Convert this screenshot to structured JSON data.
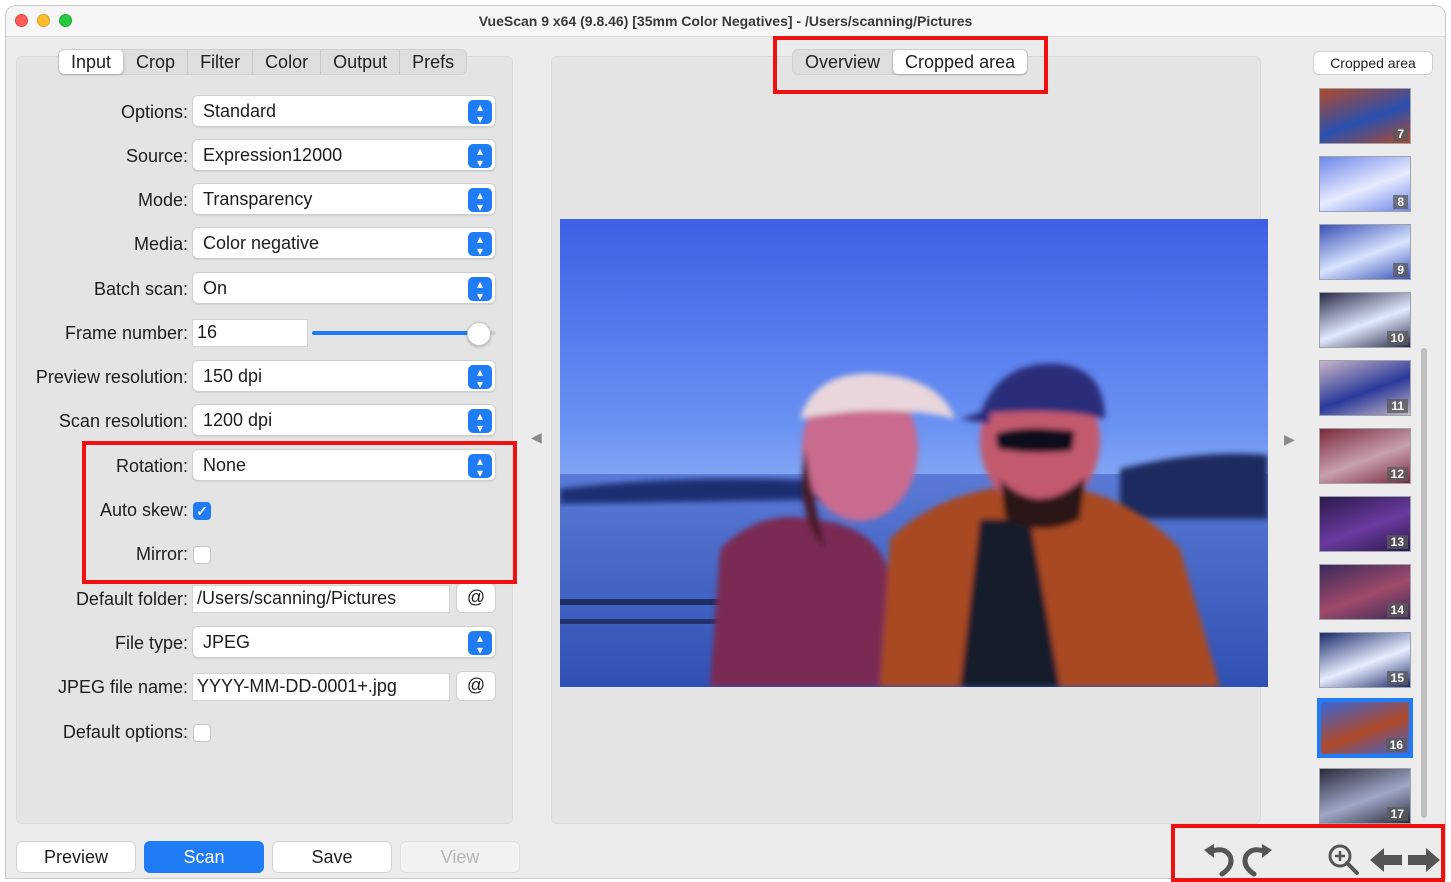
{
  "window": {
    "title": "VueScan 9 x64 (9.8.46) [35mm Color Negatives] - /Users/scanning/Pictures"
  },
  "main_tabs": [
    "Input",
    "Crop",
    "Filter",
    "Color",
    "Output",
    "Prefs"
  ],
  "active_main_tab": "Input",
  "view_tabs": [
    "Overview",
    "Cropped area"
  ],
  "active_view_tab": "Cropped area",
  "right_panel": {
    "label": "Cropped area"
  },
  "form": {
    "options": {
      "label": "Options:",
      "value": "Standard"
    },
    "source": {
      "label": "Source:",
      "value": "Expression12000"
    },
    "mode": {
      "label": "Mode:",
      "value": "Transparency"
    },
    "media": {
      "label": "Media:",
      "value": "Color negative"
    },
    "batch_scan": {
      "label": "Batch scan:",
      "value": "On"
    },
    "frame_number": {
      "label": "Frame number:",
      "value": "16",
      "slider_fraction": 0.9
    },
    "preview_resolution": {
      "label": "Preview resolution:",
      "value": "150 dpi"
    },
    "scan_resolution": {
      "label": "Scan resolution:",
      "value": "1200 dpi"
    },
    "rotation": {
      "label": "Rotation:",
      "value": "None"
    },
    "auto_skew": {
      "label": "Auto skew:",
      "checked": true
    },
    "mirror": {
      "label": "Mirror:",
      "checked": false
    },
    "default_folder": {
      "label": "Default folder:",
      "value": "/Users/scanning/Pictures",
      "button": "@"
    },
    "file_type": {
      "label": "File type:",
      "value": "JPEG"
    },
    "jpeg_file_name": {
      "label": "JPEG file name:",
      "value": "YYYY-MM-DD-0001+.jpg",
      "button": "@"
    },
    "default_options": {
      "label": "Default options:",
      "checked": false
    }
  },
  "bottom_buttons": {
    "preview": "Preview",
    "scan": "Scan",
    "save": "Save",
    "view": "View"
  },
  "thumbnails": [
    "7",
    "8",
    "9",
    "10",
    "11",
    "12",
    "13",
    "14",
    "15",
    "16",
    "17"
  ],
  "selected_thumbnail": "16",
  "toolbar_icons": [
    "rotate-left-icon",
    "rotate-right-icon",
    "zoom-in-icon",
    "arrow-left-icon",
    "arrow-right-icon"
  ],
  "colors": {
    "accent": "#1f7cf4",
    "highlight": "#ee1111"
  }
}
